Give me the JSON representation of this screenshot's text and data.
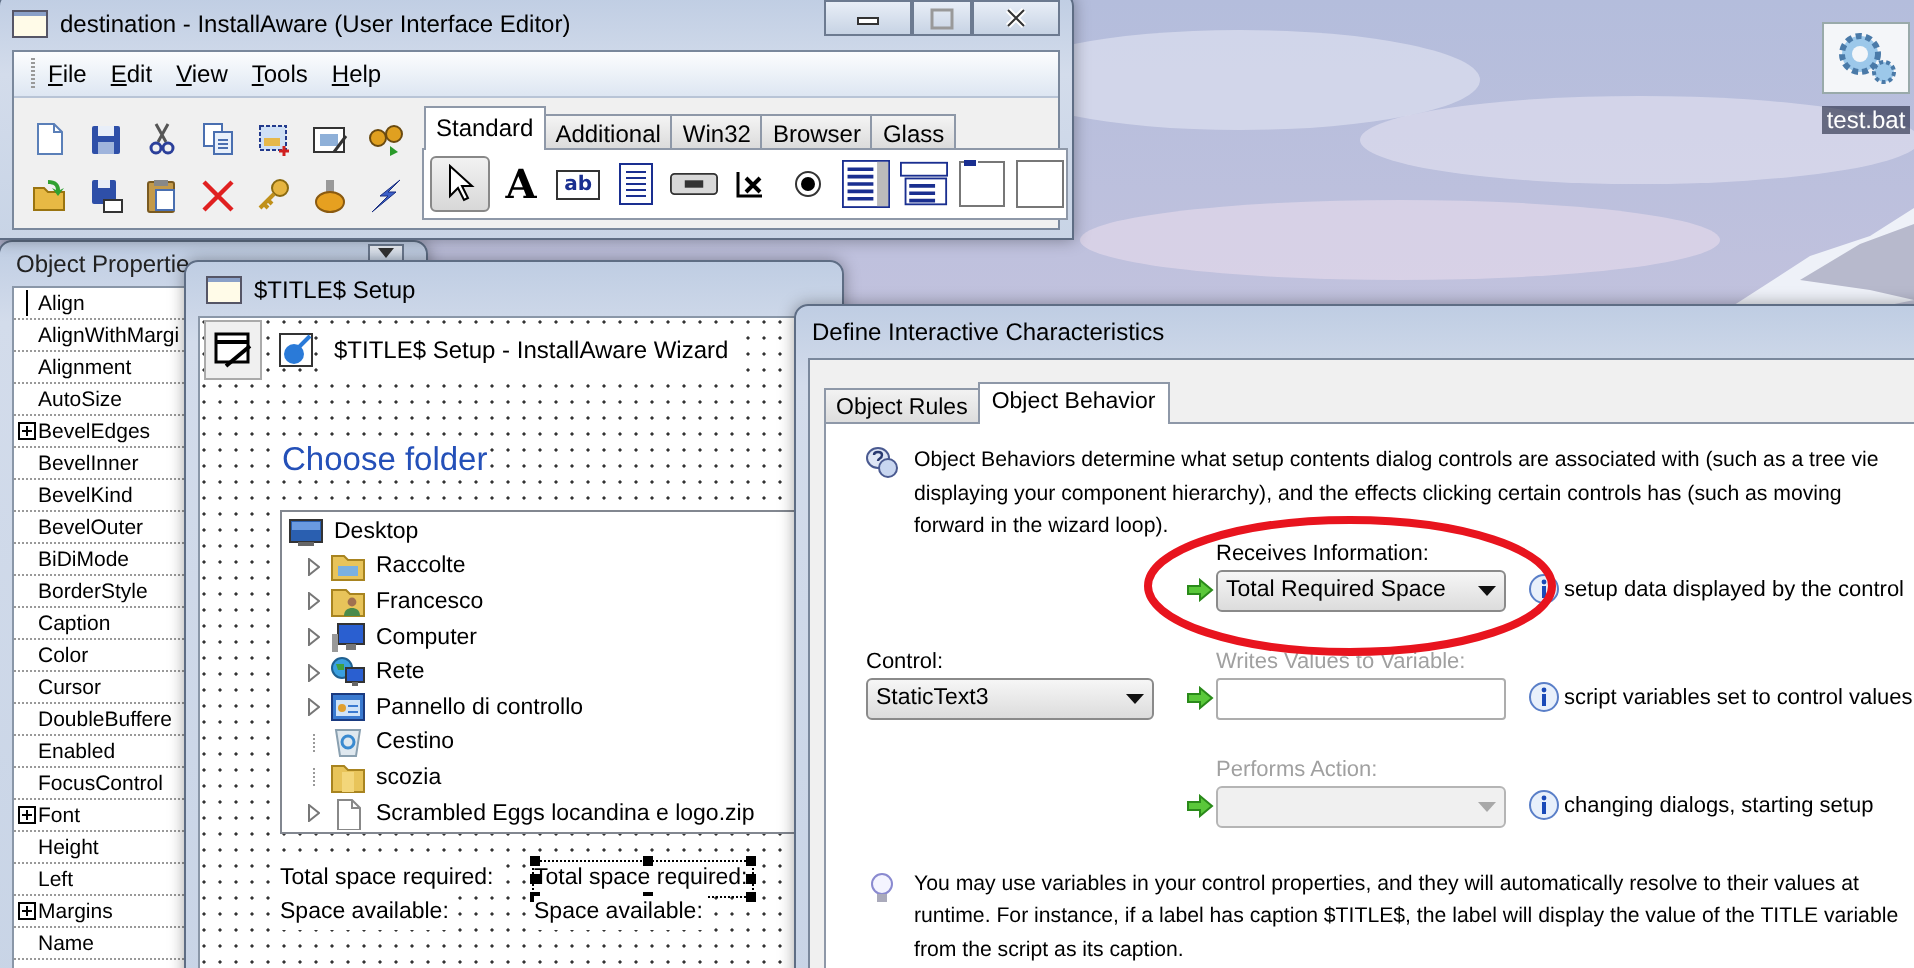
{
  "desktop": {
    "icons": [
      {
        "label": "test.bat"
      }
    ]
  },
  "editor_window": {
    "title": "destination - InstallAware (User Interface Editor)",
    "menu": [
      "File",
      "Edit",
      "View",
      "Tools",
      "Help"
    ],
    "palette_tabs": [
      {
        "label": "Standard",
        "selected": true
      },
      {
        "label": "Additional",
        "selected": false
      },
      {
        "label": "Win32",
        "selected": false
      },
      {
        "label": "Browser",
        "selected": false
      },
      {
        "label": "Glass",
        "selected": false
      }
    ],
    "tools": [
      {
        "kind": "pointer",
        "selected": true
      },
      {
        "kind": "label",
        "glyph": "A",
        "selected": false
      },
      {
        "kind": "edit",
        "glyph": "ab",
        "selected": false
      },
      {
        "kind": "memo",
        "selected": false
      },
      {
        "kind": "button",
        "selected": false
      },
      {
        "kind": "checkbox",
        "selected": false
      },
      {
        "kind": "radio",
        "selected": false
      },
      {
        "kind": "listbox",
        "selected": false
      },
      {
        "kind": "combobox",
        "selected": false
      },
      {
        "kind": "groupbox",
        "selected": false
      },
      {
        "kind": "panel",
        "selected": false
      }
    ]
  },
  "properties_window": {
    "title": "Object Propertie",
    "properties": [
      {
        "name": "Align",
        "expandable": false,
        "selected": true
      },
      {
        "name": "AlignWithMargi",
        "expandable": false,
        "selected": false
      },
      {
        "name": "Alignment",
        "expandable": false,
        "selected": false
      },
      {
        "name": "AutoSize",
        "expandable": false,
        "selected": false
      },
      {
        "name": "BevelEdges",
        "expandable": true,
        "selected": false
      },
      {
        "name": "BevelInner",
        "expandable": false,
        "selected": false
      },
      {
        "name": "BevelKind",
        "expandable": false,
        "selected": false
      },
      {
        "name": "BevelOuter",
        "expandable": false,
        "selected": false
      },
      {
        "name": "BiDiMode",
        "expandable": false,
        "selected": false
      },
      {
        "name": "BorderStyle",
        "expandable": false,
        "selected": false
      },
      {
        "name": "Caption",
        "expandable": false,
        "selected": false
      },
      {
        "name": "Color",
        "expandable": false,
        "selected": false
      },
      {
        "name": "Cursor",
        "expandable": false,
        "selected": false
      },
      {
        "name": "DoubleBuffere",
        "expandable": false,
        "selected": false
      },
      {
        "name": "Enabled",
        "expandable": false,
        "selected": false
      },
      {
        "name": "FocusControl",
        "expandable": false,
        "selected": false
      },
      {
        "name": "Font",
        "expandable": true,
        "selected": false
      },
      {
        "name": "Height",
        "expandable": false,
        "selected": false
      },
      {
        "name": "Left",
        "expandable": false,
        "selected": false
      },
      {
        "name": "Margins",
        "expandable": true,
        "selected": false
      },
      {
        "name": "Name",
        "expandable": false,
        "selected": false
      }
    ]
  },
  "setup_window": {
    "title": "$TITLE$ Setup",
    "header": "$TITLE$ Setup - InstallAware Wizard",
    "heading": "Choose folder",
    "folders": [
      {
        "label": "Desktop",
        "kind": "desktop",
        "children": [
          {
            "label": "Raccolte",
            "kind": "library",
            "expandable": true
          },
          {
            "label": "Francesco",
            "kind": "user",
            "expandable": true
          },
          {
            "label": "Computer",
            "kind": "computer",
            "expandable": true
          },
          {
            "label": "Rete",
            "kind": "network",
            "expandable": true
          },
          {
            "label": "Pannello di controllo",
            "kind": "control_panel",
            "expandable": true
          },
          {
            "label": "Cestino",
            "kind": "recycle_bin",
            "expandable": false
          },
          {
            "label": "scozia",
            "kind": "folder",
            "expandable": false
          },
          {
            "label": "Scrambled Eggs locandina e logo.zip",
            "kind": "file",
            "expandable": true
          }
        ]
      }
    ],
    "label_columns": [
      {
        "labels": [
          {
            "text": "Total space required:",
            "selected": false
          },
          {
            "text": "Space available:",
            "selected": false
          }
        ]
      },
      {
        "labels": [
          {
            "text": "Total space required:",
            "selected": true
          },
          {
            "text": "Space available:",
            "selected": false
          }
        ]
      }
    ]
  },
  "dialog": {
    "title": "Define Interactive Characteristics",
    "tabs": [
      {
        "label": "Object Rules",
        "selected": false
      },
      {
        "label": "Object Behavior",
        "selected": true
      }
    ],
    "intro": [
      "Object Behaviors determine what setup contents dialog controls are associated with (such as a tree vie",
      "displaying your component hierarchy), and the effects clicking certain controls has (such as moving",
      "forward in the wizard loop)."
    ],
    "control": {
      "label": "Control:",
      "value": "StaticText3"
    },
    "behaviors": [
      {
        "kind": "combo",
        "label": "Receives Information:",
        "value": "Total Required Space",
        "note": "setup data displayed by the control",
        "disabled": false,
        "highlighted": true
      },
      {
        "kind": "field",
        "label": "Writes Values to Variable:",
        "note": "script variables set to control values",
        "disabled": true,
        "highlighted": false
      },
      {
        "kind": "combo",
        "label": "Performs Action:",
        "note": "changing dialogs, starting setup",
        "disabled": true,
        "highlighted": false
      }
    ],
    "tip": [
      "You may use variables in your control properties, and they will automatically resolve to their values at",
      "runtime. For instance, if a label has caption $TITLE$, the label will display the value of the TITLE variable",
      "from the script as its caption."
    ]
  }
}
